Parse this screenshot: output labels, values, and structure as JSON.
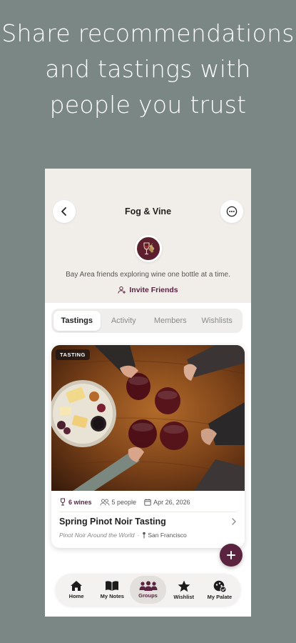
{
  "headline": [
    "Share recommendations",
    "and tastings with",
    "people you trust"
  ],
  "group": {
    "title": "Fog & Vine",
    "description": "Bay Area friends exploring wine one bottle at a time.",
    "invite_label": "Invite Friends"
  },
  "tabs": [
    {
      "label": "Tastings",
      "active": true
    },
    {
      "label": "Activity",
      "active": false
    },
    {
      "label": "Members",
      "active": false
    },
    {
      "label": "Wishlists",
      "active": false
    }
  ],
  "card": {
    "badge": "TASTING",
    "wines": "6 wines",
    "people": "5 people",
    "date": "Apr 26, 2026",
    "title": "Spring Pinot Noir Tasting",
    "series": "Pinot Noir Around the World",
    "separator": "·",
    "location": "San Francisco"
  },
  "nav": [
    {
      "label": "Home",
      "icon": "home-icon"
    },
    {
      "label": "My Notes",
      "icon": "book-icon"
    },
    {
      "label": "Groups",
      "icon": "groups-icon",
      "active": true
    },
    {
      "label": "Wishlist",
      "icon": "star-icon"
    },
    {
      "label": "My Palate",
      "icon": "palate-icon"
    }
  ],
  "colors": {
    "background": "#7a8785",
    "accent": "#5a2440",
    "header_bg": "#f1eeea"
  }
}
